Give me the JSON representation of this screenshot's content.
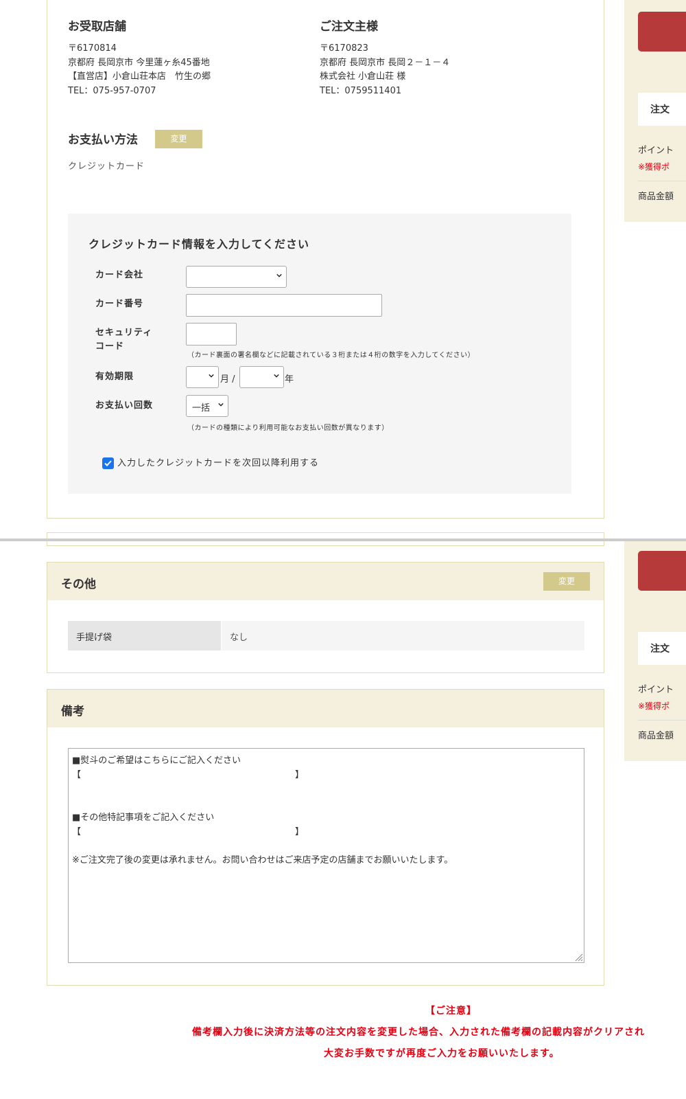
{
  "pickup_store": {
    "heading": "お受取店舗",
    "postal": "〒6170814",
    "address": "京都府 長岡京市 今里蓮ヶ糸45番地",
    "store": "【直営店】小倉山荘本店　竹生の郷",
    "tel": "TEL：075-957-0707"
  },
  "orderer": {
    "heading": "ご注文主様",
    "postal": "〒6170823",
    "address": "京都府 長岡京市 長岡２－１－４",
    "name": "株式会社 小倉山荘 様",
    "tel": "TEL：0759511401"
  },
  "payment": {
    "heading": "お支払い方法",
    "change_label": "変更",
    "method": "クレジットカード"
  },
  "credit_card": {
    "title": "クレジットカード情報を入力してください",
    "company_label": "カード会社",
    "company_value": "",
    "number_label": "カード番号",
    "number_value": "",
    "security_label_1": "セキュリティ",
    "security_label_2": "コード",
    "security_value": "",
    "security_note": "（カード裏面の署名欄などに記載されている３桁または４桁の数字を入力してください）",
    "expiry_label": "有効期限",
    "expiry_month": "",
    "expiry_month_unit": "月 /",
    "expiry_year": "",
    "expiry_year_unit": "年",
    "installments_label": "お支払い回数",
    "installments_value": "一括",
    "installments_note": "（カードの種類により利用可能なお支払い回数が異なります）",
    "save_card_label": "入力したクレジットカードを次回以降利用する",
    "save_card_checked": true
  },
  "other": {
    "heading": "その他",
    "change_label": "変更",
    "bag_label": "手提げ袋",
    "bag_value": "なし"
  },
  "remarks": {
    "heading": "備考",
    "line1": "■熨斗のご希望はこちらにご記入ください",
    "line2": "【　　　　　　　　　　　　　　　　　　　　　　　　】",
    "line3": "■その他特記事項をご記入ください",
    "line4": "【　　　　　　　　　　　　　　　　　　　　　　　　】",
    "line5": "※ご注文完了後の変更は承れません。お問い合わせはご来店予定の店舗までお願いいたします。"
  },
  "caution": {
    "title": "【ご注意】",
    "line1": "備考欄入力後に決済方法等の注文内容を変更した場合、入力された備考欄の記載内容がクリアされ",
    "line2": "大変お手数ですが再度ご入力をお願いいたします。"
  },
  "sidebar": {
    "order_label": "注文",
    "points_label": "ポイント",
    "points_note": "※獲得ポ",
    "subtotal_label": "商品金額"
  },
  "colors": {
    "accent_gold": "#d3c98a",
    "panel_border": "#e2dcb6",
    "section_header_bg": "#f5efdd",
    "caution_red": "#e60012",
    "side_button_red": "#b73a3a",
    "checkbox_blue": "#1a73e8"
  }
}
